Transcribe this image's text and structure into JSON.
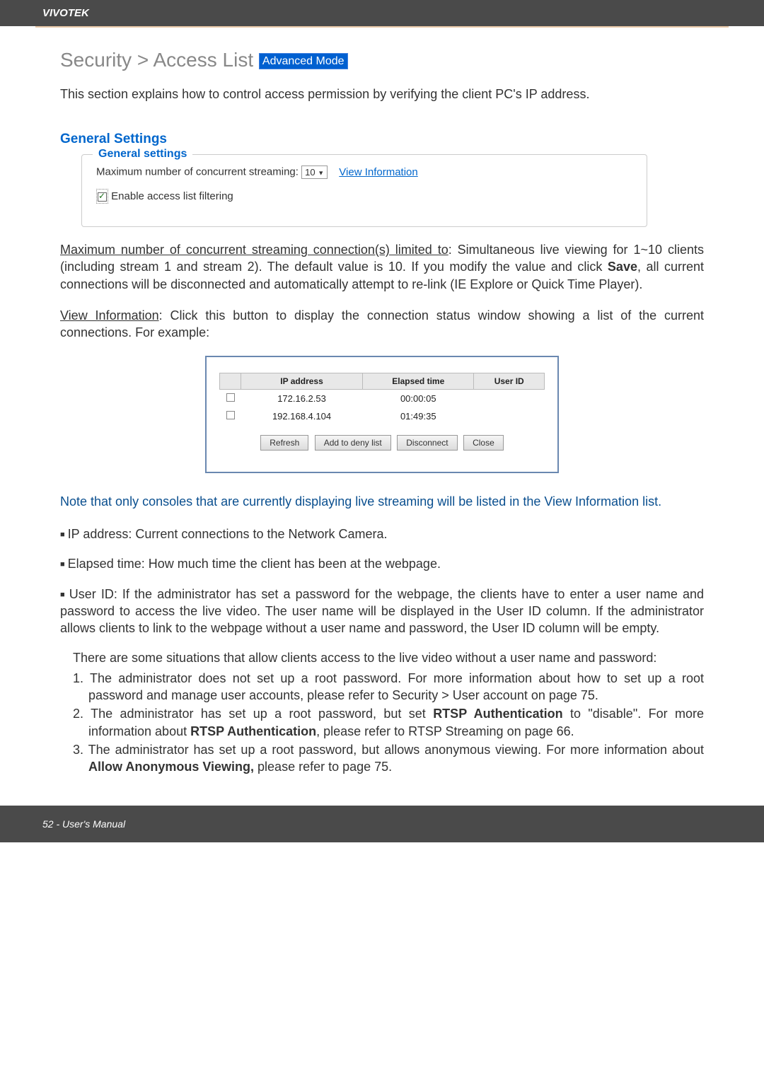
{
  "header": {
    "brand": "VIVOTEK"
  },
  "title": {
    "text": "Security >  Access List",
    "badge": "Advanced Mode"
  },
  "intro": "This section explains how to control access permission by verifying the client PC's IP address.",
  "general": {
    "heading": "General Settings",
    "boxTitle": "General settings",
    "maxLabel": "Maximum number of concurrent streaming:",
    "maxValue": "10",
    "viewInfo": "View Information",
    "enableFiltering": "Enable access list filtering"
  },
  "maxPara": {
    "underlined": "Maximum number of concurrent streaming connection(s) limited to",
    "rest1": ": Simultaneous live viewing for 1~10 clients (including stream 1 and stream 2). The default value is 10. If you modify the value and click ",
    "save": "Save",
    "rest2": ", all current connections will be disconnected and automatically attempt to re-link (IE Explore or Quick Time Player)."
  },
  "viewInfoPara": {
    "underlined": "View Information",
    "rest": ": Click this button to display the connection status window showing a list of the current connections. For example:"
  },
  "dialog": {
    "headers": [
      "",
      "IP address",
      "Elapsed time",
      "User ID"
    ],
    "rows": [
      {
        "ip": "172.16.2.53",
        "elapsed": "00:00:05",
        "user": ""
      },
      {
        "ip": "192.168.4.104",
        "elapsed": "01:49:35",
        "user": ""
      }
    ],
    "buttons": [
      "Refresh",
      "Add to deny list",
      "Disconnect",
      "Close"
    ]
  },
  "note": "Note that only consoles that are currently displaying live streaming will be listed in the View Information list.",
  "bullets": {
    "ip": "IP address: Current connections to the Network Camera.",
    "elapsed": "Elapsed time: How much time the client has been at the webpage.",
    "userId": "User ID: If the administrator has set a password for the webpage, the clients have to enter a user name and password to access the live video. The user name will be displayed in the User ID column. If  the administrator allows clients to link to the webpage without a user name and password, the User ID column will be empty."
  },
  "situations": {
    "lead": "There are some situations that allow clients access to the live video without a user name and password:",
    "1": "1. The administrator does not set up a root password. For more information about how to set up a root password and manage user accounts, please refer to Security > User account on page 75.",
    "2a": "2. The administrator has set up a root password, but set ",
    "2b": "RTSP Authentication",
    "2c": " to \"disable\". For more information about ",
    "2d": "RTSP Authentication",
    "2e": ", please refer to RTSP Streaming on page 66.",
    "3a": "3. The administrator has set up a root password, but allows anonymous viewing. For more information about ",
    "3b": "Allow Anonymous Viewing,",
    "3c": " please refer to page 75."
  },
  "footer": "52 - User's Manual"
}
